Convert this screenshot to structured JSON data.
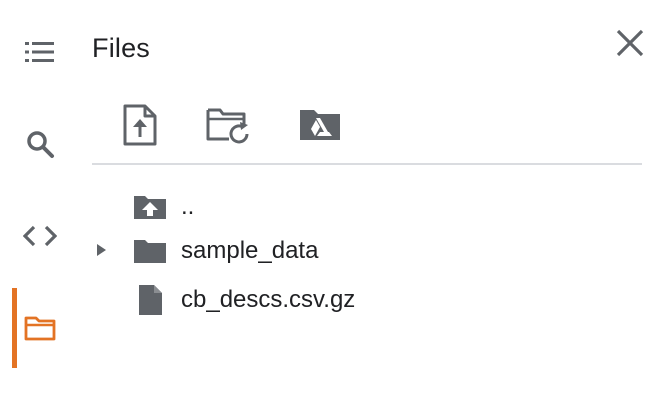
{
  "panel": {
    "title": "Files"
  },
  "rail": {
    "items": [
      {
        "name": "table-of-contents",
        "icon": "list-icon"
      },
      {
        "name": "search",
        "icon": "search-icon"
      },
      {
        "name": "code-snippets",
        "icon": "code-icon"
      },
      {
        "name": "files",
        "icon": "folder-icon",
        "active": true
      }
    ],
    "active_color": "#e37324"
  },
  "toolbar": {
    "buttons": [
      {
        "icon": "upload-file-icon"
      },
      {
        "icon": "refresh-folder-icon"
      },
      {
        "icon": "mount-drive-icon"
      }
    ]
  },
  "tree": {
    "items": [
      {
        "label": "..",
        "icon": "parent-folder-icon"
      },
      {
        "label": "sample_data",
        "icon": "folder-icon",
        "expandable": true
      },
      {
        "label": "cb_descs.csv.gz",
        "icon": "file-icon"
      }
    ]
  },
  "colors": {
    "icon": "#5f6368",
    "accent": "#e37324",
    "divider": "#dadce0"
  }
}
